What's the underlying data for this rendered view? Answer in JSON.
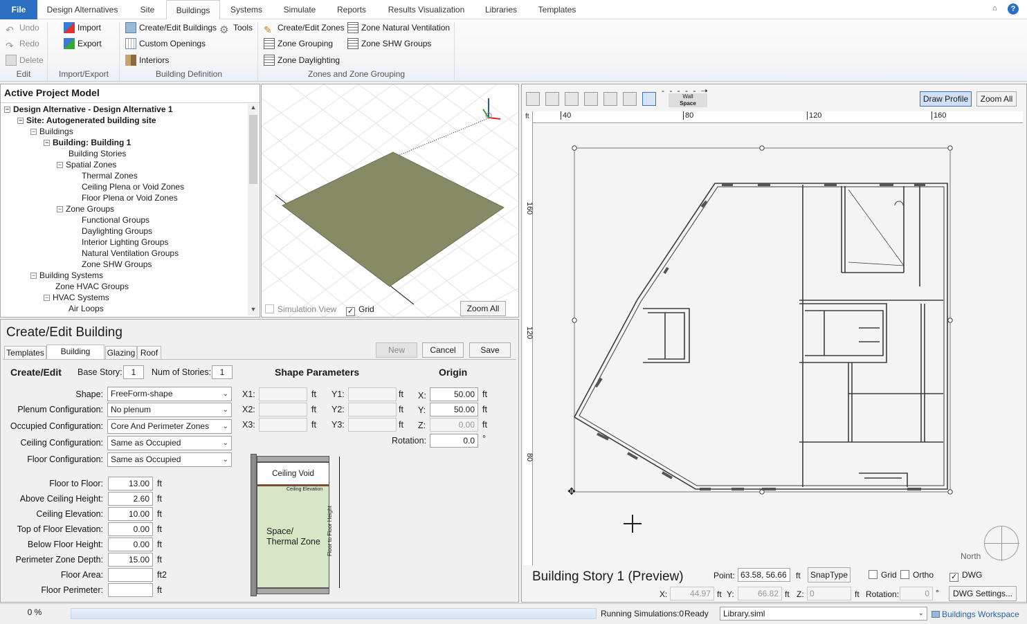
{
  "menubar": {
    "file": "File",
    "tabs": [
      "Design Alternatives",
      "Site",
      "Buildings",
      "Systems",
      "Simulate",
      "Reports",
      "Results Visualization",
      "Libraries",
      "Templates"
    ]
  },
  "ribbon": {
    "edit": {
      "undo": "Undo",
      "redo": "Redo",
      "delete": "Delete",
      "label": "Edit"
    },
    "importexport": {
      "import": "Import",
      "export": "Export",
      "label": "Import/Export"
    },
    "building_def": {
      "create_edit": "Create/Edit Buildings",
      "tools": "Tools",
      "custom_openings": "Custom Openings",
      "interiors": "Interiors",
      "label": "Building Definition"
    },
    "zones": {
      "create_edit_zones": "Create/Edit Zones",
      "zone_grouping": "Zone Grouping",
      "zone_daylighting": "Zone Daylighting",
      "natural_ventilation": "Zone Natural Ventilation",
      "shw_groups": "Zone SHW Groups",
      "label": "Zones and Zone Grouping"
    }
  },
  "tree": {
    "title": "Active Project Model",
    "items": [
      "Design Alternative - Design Alternative 1",
      "Site: Autogenerated building site",
      "Buildings",
      "Building: Building  1",
      "Building Stories",
      "Spatial Zones",
      "Thermal Zones",
      "Ceiling Plena or Void Zones",
      "Floor Plena or Void Zones",
      "Zone Groups",
      "Functional Groups",
      "Daylighting Groups",
      "Interior Lighting Groups",
      "Natural Ventilation Groups",
      "Zone SHW Groups",
      "Building Systems",
      "Zone HVAC Groups",
      "HVAC Systems",
      "Air Loops"
    ]
  },
  "view3d": {
    "sim_view": "Simulation View",
    "grid": "Grid",
    "zoom_all": "Zoom All"
  },
  "editor": {
    "title": "Create/Edit Building",
    "tabs": [
      "Templates",
      "Building Stories",
      "Glazing",
      "Roof"
    ],
    "new": "New",
    "cancel": "Cancel",
    "save": "Save",
    "section_create": "Create/Edit",
    "base_story_label": "Base Story:",
    "base_story": "1",
    "num_stories_label": "Num of Stories:",
    "num_stories": "1",
    "shape_params": "Shape Parameters",
    "origin": "Origin",
    "config": [
      {
        "label": "Shape:",
        "value": "FreeForm-shape"
      },
      {
        "label": "Plenum Configuration:",
        "value": "No plenum"
      },
      {
        "label": "Occupied Configuration:",
        "value": "Core And Perimeter Zones"
      },
      {
        "label": "Ceiling Configuration:",
        "value": "Same as Occupied"
      },
      {
        "label": "Floor Configuration:",
        "value": "Same as Occupied"
      }
    ],
    "x1": "X1:",
    "x2": "X2:",
    "x3": "X3:",
    "y1": "Y1:",
    "y2": "Y2:",
    "y3": "Y3:",
    "ft": "ft",
    "origin_x_label": "X:",
    "origin_x": "50.00",
    "origin_y_label": "Y:",
    "origin_y": "50.00",
    "origin_z_label": "Z:",
    "origin_z": "0.00",
    "rotation_label": "Rotation:",
    "rotation": "0.0",
    "deg": "°",
    "dims": [
      {
        "label": "Floor to Floor:",
        "value": "13.00",
        "unit": "ft"
      },
      {
        "label": "Above Ceiling Height:",
        "value": "2.60",
        "unit": "ft"
      },
      {
        "label": "Ceiling Elevation:",
        "value": "10.00",
        "unit": "ft"
      },
      {
        "label": "Top of Floor Elevation:",
        "value": "0.00",
        "unit": "ft"
      },
      {
        "label": "Below Floor Height:",
        "value": "0.00",
        "unit": "ft"
      },
      {
        "label": "Perimeter Zone Depth:",
        "value": "15.00",
        "unit": "ft"
      },
      {
        "label": "Floor Area:",
        "value": "",
        "unit": "ft2"
      },
      {
        "label": "Floor Perimeter:",
        "value": "",
        "unit": "ft"
      }
    ],
    "diagram": {
      "ceiling_void": "Ceiling Void",
      "ceiling_elev": "Ceiling Elevation",
      "space_1": "Space/",
      "space_2": "Thermal Zone",
      "f2f": "Floor to Floor Height"
    }
  },
  "plan": {
    "wall": "Wall",
    "space": "Space",
    "draw_profile": "Draw Profile",
    "zoom_all": "Zoom All",
    "ruler_unit": "ft",
    "ruler_x": [
      "40",
      "80",
      "120",
      "160"
    ],
    "ruler_y": [
      "160",
      "120",
      "80"
    ],
    "north": "North",
    "story_title": "Building Story 1 (Preview)",
    "point_label": "Point:",
    "point": "63.58, 56.66",
    "ft": "ft",
    "snap": "SnapType",
    "grid": "Grid",
    "ortho": "Ortho",
    "dwg": "DWG",
    "x_label": "X:",
    "x": "44.97",
    "y_label": "Y:",
    "y": "66.82",
    "z_label": "Z:",
    "z": "0",
    "rotation_label": "Rotation:",
    "rotation": "0",
    "deg": "°",
    "dwg_settings": "DWG Settings..."
  },
  "status": {
    "progress": "0 %",
    "running": "Running Simulations:0",
    "ready": "Ready",
    "library": "Library.siml",
    "workspace": "Buildings Workspace"
  }
}
